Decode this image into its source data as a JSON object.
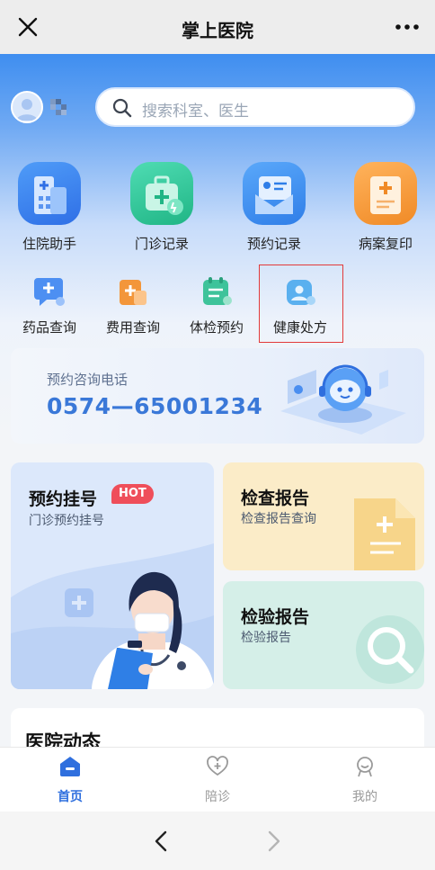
{
  "header": {
    "title": "掌上医院",
    "close_icon": "close-icon",
    "more_icon": "more-icon"
  },
  "search": {
    "placeholder": "搜索科室、医生"
  },
  "main_services": [
    {
      "label": "住院助手",
      "icon": "hospital-building-icon",
      "color": "#3b82f0"
    },
    {
      "label": "门诊记录",
      "icon": "medical-kit-icon",
      "color": "#2ec79c"
    },
    {
      "label": "预约记录",
      "icon": "appointment-card-icon",
      "color": "#3b8ff0"
    },
    {
      "label": "病案复印",
      "icon": "medical-record-icon",
      "color": "#f59a3b"
    }
  ],
  "sub_services": [
    {
      "label": "药品查询",
      "icon": "medicine-search-icon"
    },
    {
      "label": "费用查询",
      "icon": "fee-query-icon"
    },
    {
      "label": "体检预约",
      "icon": "checkup-calendar-icon"
    },
    {
      "label": "健康处方",
      "icon": "health-prescription-icon"
    }
  ],
  "banner": {
    "label": "预约咨询电话",
    "phone": "0574—65001234"
  },
  "cards": {
    "registration": {
      "title": "预约挂号",
      "badge": "HOT",
      "subtitle": "门诊预约挂号"
    },
    "exam_report": {
      "title": "检查报告",
      "subtitle": "检查报告查询"
    },
    "lab_report": {
      "title": "检验报告",
      "subtitle": "检验报告"
    }
  },
  "news": {
    "title": "医院动态"
  },
  "tabbar": [
    {
      "label": "首页",
      "icon": "home-icon",
      "active": true
    },
    {
      "label": "陪诊",
      "icon": "escort-heart-icon",
      "active": false
    },
    {
      "label": "我的",
      "icon": "profile-icon",
      "active": false
    }
  ],
  "colors": {
    "accent": "#2f6fde",
    "hot_badge": "#ef4e5a",
    "highlight_box": "#e23a3a"
  }
}
